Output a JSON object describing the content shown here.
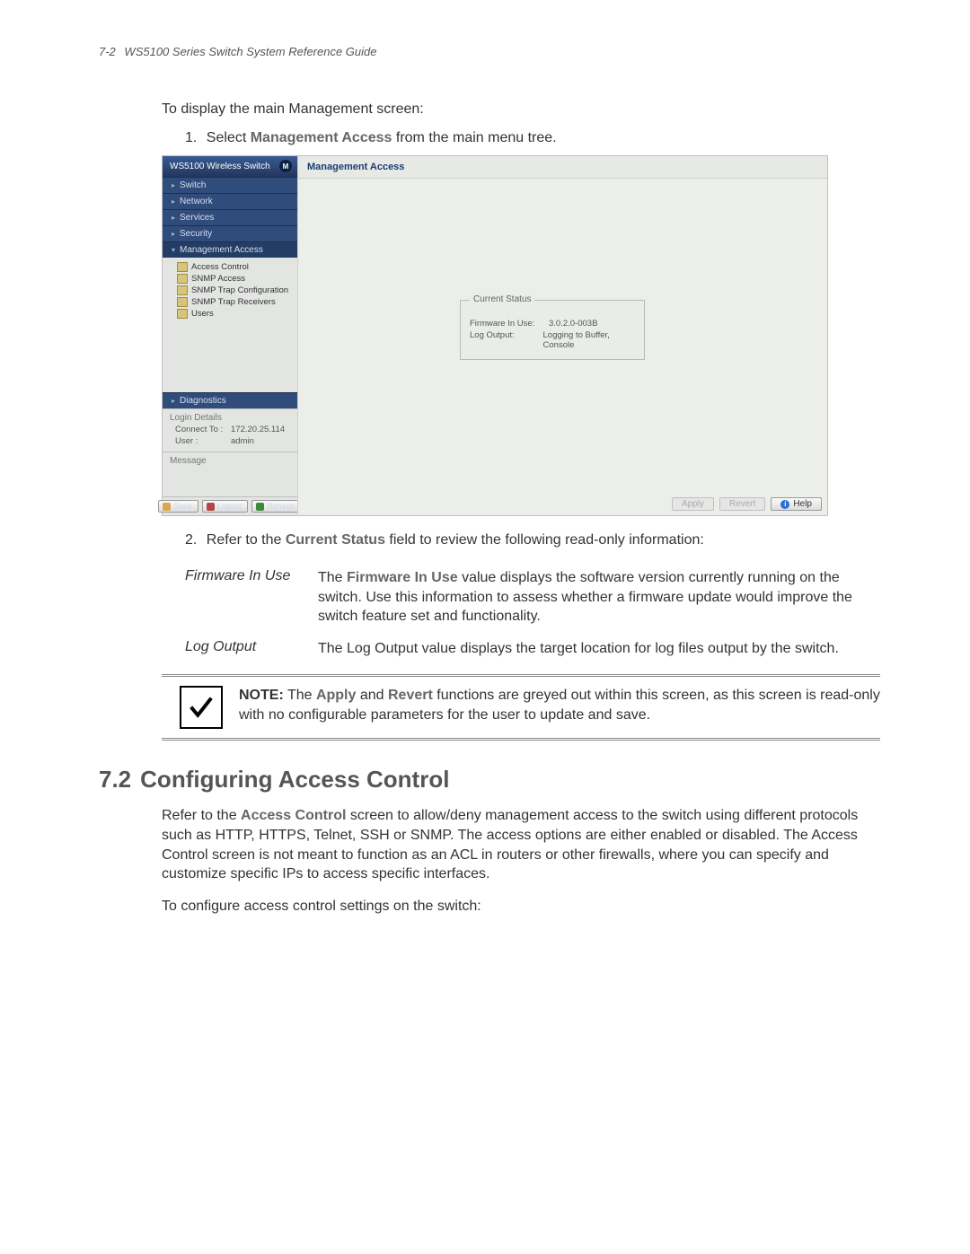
{
  "header": {
    "page_number": "7-2",
    "doc_title": "WS5100 Series Switch System Reference Guide"
  },
  "intro": "To display the main Management screen:",
  "step1": {
    "num": "1.",
    "pre": "Select ",
    "bold": "Management Access",
    "post": " from the main menu tree."
  },
  "step2": {
    "num": "2.",
    "pre": "Refer to the ",
    "bold": "Current Status",
    "post": " field to review the following read-only information:"
  },
  "app": {
    "product_title": "WS5100 Wireless Switch",
    "logo_text": "M",
    "nav": {
      "switch": "Switch",
      "network": "Network",
      "services": "Services",
      "security": "Security",
      "mgmt": "Management Access",
      "diagnostics": "Diagnostics"
    },
    "tree": {
      "access_control": "Access Control",
      "snmp_access": "SNMP Access",
      "snmp_trap_conf": "SNMP Trap Configuration",
      "snmp_trap_recv": "SNMP Trap Receivers",
      "users": "Users"
    },
    "login": {
      "title": "Login Details",
      "connect_label": "Connect To :",
      "connect_val": "172.20.25.114",
      "user_label": "User :",
      "user_val": "admin"
    },
    "message_title": "Message",
    "sb_btn": {
      "save": "Save",
      "logout": "Logout",
      "refresh": "Refresh"
    },
    "content_title": "Management Access",
    "status": {
      "legend": "Current Status",
      "fw_label": "Firmware In Use:",
      "fw_val": "3.0.2.0-003B",
      "log_label": "Log Output:",
      "log_val": "Logging to Buffer, Console"
    },
    "btns": {
      "apply": "Apply",
      "revert": "Revert",
      "help": "Help"
    }
  },
  "defs": {
    "fw_term": "Firmware In Use",
    "fw_val_pre": "The ",
    "fw_val_bold": "Firmware In Use",
    "fw_val_post": " value displays the software version currently running on the switch. Use this information to assess whether a firmware update would improve the switch feature set and functionality.",
    "log_term": "Log Output",
    "log_val": "The Log Output value displays the target location for log files output by the switch."
  },
  "note": {
    "lead": "NOTE:",
    "p1a": " The ",
    "apply": "Apply",
    "p1b": " and ",
    "revert": "Revert",
    "p1c": " functions are greyed out within this screen, as this screen is read-only with no configurable parameters for the user to update and save."
  },
  "section": {
    "num": "7.2",
    "title": "Configuring Access Control"
  },
  "sec_para_pre": "Refer to the ",
  "sec_para_bold": "Access Control",
  "sec_para_post": " screen to allow/deny management access to the switch using different protocols such as HTTP, HTTPS, Telnet, SSH or SNMP. The access options are either enabled or disabled. The Access Control screen is not meant to function as an ACL in routers or other firewalls, where you can specify and customize specific IPs to access specific interfaces.",
  "sec_line2": "To configure access control settings on the switch:"
}
